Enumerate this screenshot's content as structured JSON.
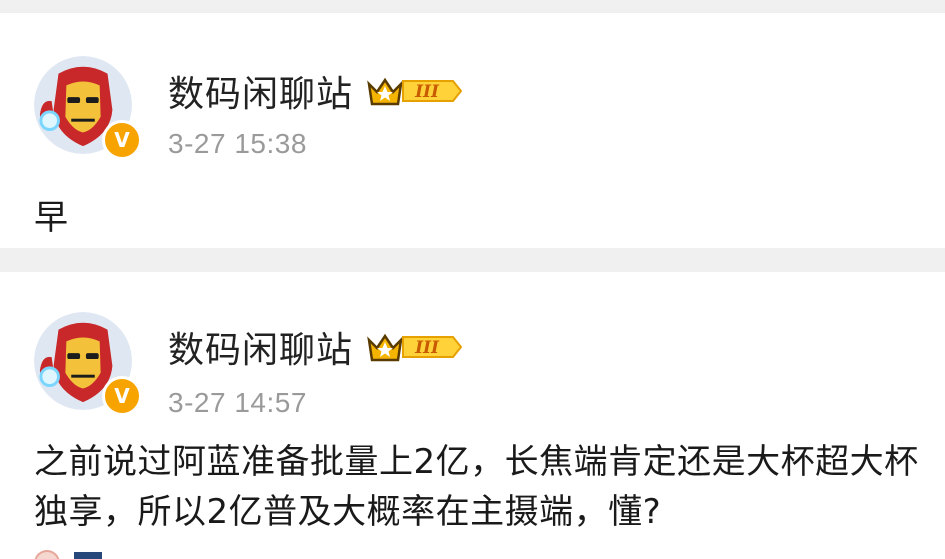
{
  "posts": [
    {
      "username": "数码闲聊站",
      "vip_level": "III",
      "timestamp": "3-27 15:38",
      "content": "早",
      "verified_mark": "V"
    },
    {
      "username": "数码闲聊站",
      "vip_level": "III",
      "timestamp": "3-27 14:57",
      "content": "之前说过阿蓝准备批量上2亿，长焦端肯定还是大杯超大杯独享，所以2亿普及大概率在主摄端，懂?",
      "verified_mark": "V"
    }
  ],
  "colors": {
    "verified_badge": "#f7a400",
    "vip_gold": "#f4b400",
    "background": "#f1f1f1",
    "card": "#ffffff",
    "timestamp": "#9a9a9a"
  },
  "icons": {
    "avatar": "iron-man-avatar-icon",
    "verified": "verified-v-icon",
    "vip": "crown-vip-badge-icon"
  }
}
